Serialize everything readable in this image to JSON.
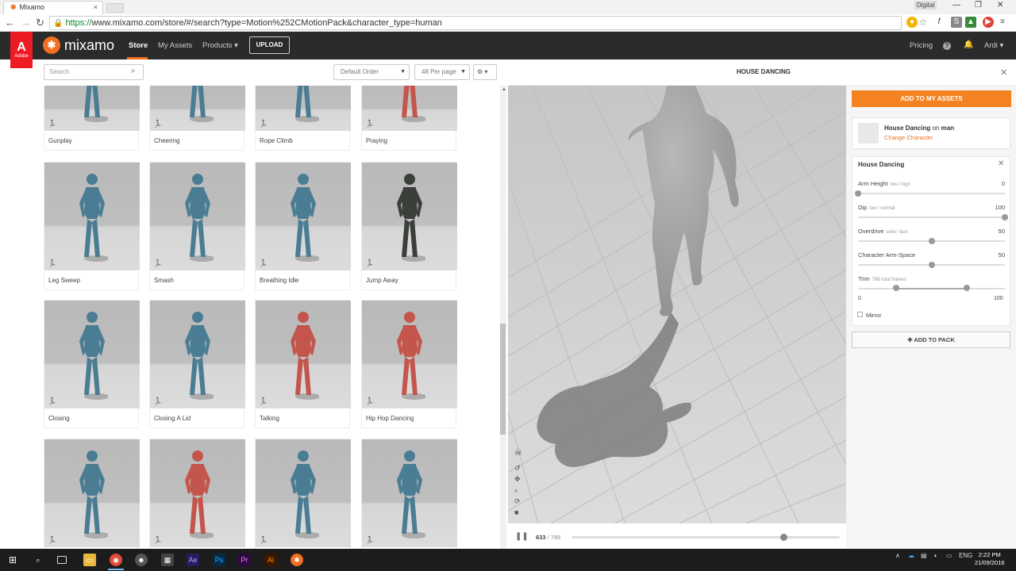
{
  "browser": {
    "tab_title": "Mixamo",
    "tab_close": "×",
    "url_scheme": "https://",
    "url_rest": "www.mixamo.com/store/#/search?type=Motion%252CMotionPack&character_type=human",
    "profile_badge": "Digital",
    "window_controls": [
      "—",
      "❐",
      "✕"
    ]
  },
  "header": {
    "adobe_logo": "Adobe",
    "brand": "mixamo",
    "nav": [
      "Store",
      "My Assets",
      "Products ▾"
    ],
    "upload_label": "UPLOAD",
    "pricing": "Pricing",
    "help": "?",
    "user": "Ardi ▾"
  },
  "toolbar": {
    "search_placeholder": "Search",
    "sort": "Default Order",
    "per_page": "48 Per page",
    "settings": "⚙ ▾"
  },
  "cards": [
    {
      "label": "Gunplay",
      "color": "blue"
    },
    {
      "label": "Cheering",
      "color": "blue"
    },
    {
      "label": "Rope Climb",
      "color": "blue"
    },
    {
      "label": "Praying",
      "color": "red"
    },
    {
      "label": "Leg Sweep",
      "color": "blue"
    },
    {
      "label": "Smash",
      "color": "blue"
    },
    {
      "label": "Breathing Idle",
      "color": "blue"
    },
    {
      "label": "Jump Away",
      "color": "dark"
    },
    {
      "label": "Closing",
      "color": "blue"
    },
    {
      "label": "Closing A Lid",
      "color": "blue"
    },
    {
      "label": "Talking",
      "color": "red"
    },
    {
      "label": "Hip Hop Dancing",
      "color": "red"
    },
    {
      "label": "",
      "color": "blue"
    },
    {
      "label": "",
      "color": "red"
    },
    {
      "label": "",
      "color": "blue"
    },
    {
      "label": "",
      "color": "blue"
    }
  ],
  "viewer": {
    "title": "HOUSE DANCING",
    "current_frame": "633",
    "total_frames": "/ 785",
    "progress": 0.79
  },
  "panel": {
    "add_to_assets": "ADD TO MY ASSETS",
    "motion_name": "House Dancing",
    "on_text": "on",
    "character": "man",
    "change_character": "Change Character",
    "params_title": "House Dancing",
    "params": [
      {
        "label": "Arm Height",
        "hint": "low / high",
        "value": "0",
        "level": 0
      },
      {
        "label": "Dip",
        "hint": "low / normal",
        "value": "100",
        "level": 1
      },
      {
        "label": "Overdrive",
        "hint": "slow / fast",
        "value": "50",
        "level": 0.5
      },
      {
        "label": "Character Arm-Space",
        "hint": "",
        "value": "50",
        "level": 0.5
      }
    ],
    "trim": {
      "label": "Trim",
      "hint": "786 total frames",
      "min": "0",
      "max": "100",
      "low": 0.26,
      "high": 0.74
    },
    "mirror": "Mirror",
    "add_to_pack": "✚ ADD TO PACK"
  },
  "taskbar": {
    "lang": "ENG",
    "time": "2:22 PM",
    "date": "21/09/2016"
  },
  "colors": {
    "accent": "#f36f21",
    "add_button": "#f58220",
    "header_bg": "#2b2b2b",
    "blue_figure": "#4a7d93",
    "red_figure": "#c4554c"
  }
}
